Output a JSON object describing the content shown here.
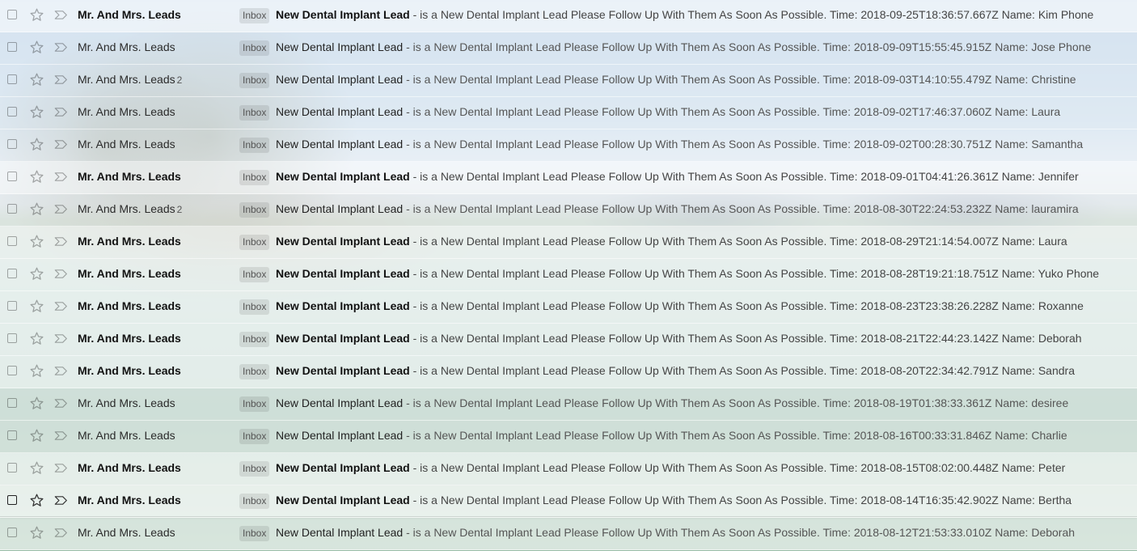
{
  "emails": [
    {
      "sender": "Mr. And Mrs. Leads",
      "count": "",
      "label": "Inbox",
      "subject": "New Dental Implant Lead",
      "snippet": " - is a New Dental Implant Lead Please Follow Up With Them As Soon As Possible. Time: 2018-09-25T18:36:57.667Z Name: Kim Phone",
      "unread": true
    },
    {
      "sender": "Mr. And Mrs. Leads",
      "count": "",
      "label": "Inbox",
      "subject": "New Dental Implant Lead",
      "snippet": " - is a New Dental Implant Lead Please Follow Up With Them As Soon As Possible. Time: 2018-09-09T15:55:45.915Z Name: Jose Phone",
      "unread": false
    },
    {
      "sender": "Mr. And Mrs. Leads",
      "count": "2",
      "label": "Inbox",
      "subject": "New Dental Implant Lead",
      "snippet": " - is a New Dental Implant Lead Please Follow Up With Them As Soon As Possible. Time: 2018-09-03T14:10:55.479Z Name: Christine",
      "unread": false
    },
    {
      "sender": "Mr. And Mrs. Leads",
      "count": "",
      "label": "Inbox",
      "subject": "New Dental Implant Lead",
      "snippet": " - is a New Dental Implant Lead Please Follow Up With Them As Soon As Possible. Time: 2018-09-02T17:46:37.060Z Name: Laura",
      "unread": false
    },
    {
      "sender": "Mr. And Mrs. Leads",
      "count": "",
      "label": "Inbox",
      "subject": "New Dental Implant Lead",
      "snippet": " - is a New Dental Implant Lead Please Follow Up With Them As Soon As Possible. Time: 2018-09-02T00:28:30.751Z Name: Samantha",
      "unread": false
    },
    {
      "sender": "Mr. And Mrs. Leads",
      "count": "",
      "label": "Inbox",
      "subject": "New Dental Implant Lead",
      "snippet": " - is a New Dental Implant Lead Please Follow Up With Them As Soon As Possible. Time: 2018-09-01T04:41:26.361Z Name: Jennifer",
      "unread": true
    },
    {
      "sender": "Mr. And Mrs. Leads",
      "count": "2",
      "label": "Inbox",
      "subject": "New Dental Implant Lead",
      "snippet": " - is a New Dental Implant Lead Please Follow Up With Them As Soon As Possible. Time: 2018-08-30T22:24:53.232Z Name: lauramira",
      "unread": false
    },
    {
      "sender": "Mr. And Mrs. Leads",
      "count": "",
      "label": "Inbox",
      "subject": "New Dental Implant Lead",
      "snippet": " - is a New Dental Implant Lead Please Follow Up With Them As Soon As Possible. Time: 2018-08-29T21:14:54.007Z Name: Laura",
      "unread": true
    },
    {
      "sender": "Mr. And Mrs. Leads",
      "count": "",
      "label": "Inbox",
      "subject": "New Dental Implant Lead",
      "snippet": " - is a New Dental Implant Lead Please Follow Up With Them As Soon As Possible. Time: 2018-08-28T19:21:18.751Z Name: Yuko Phone",
      "unread": true
    },
    {
      "sender": "Mr. And Mrs. Leads",
      "count": "",
      "label": "Inbox",
      "subject": "New Dental Implant Lead",
      "snippet": " - is a New Dental Implant Lead Please Follow Up With Them As Soon As Possible. Time: 2018-08-23T23:38:26.228Z Name: Roxanne",
      "unread": true
    },
    {
      "sender": "Mr. And Mrs. Leads",
      "count": "",
      "label": "Inbox",
      "subject": "New Dental Implant Lead",
      "snippet": " - is a New Dental Implant Lead Please Follow Up With Them As Soon As Possible. Time: 2018-08-21T22:44:23.142Z Name: Deborah",
      "unread": true
    },
    {
      "sender": "Mr. And Mrs. Leads",
      "count": "",
      "label": "Inbox",
      "subject": "New Dental Implant Lead",
      "snippet": " - is a New Dental Implant Lead Please Follow Up With Them As Soon As Possible. Time: 2018-08-20T22:34:42.791Z Name: Sandra",
      "unread": true
    },
    {
      "sender": "Mr. And Mrs. Leads",
      "count": "",
      "label": "Inbox",
      "subject": "New Dental Implant Lead",
      "snippet": " - is a New Dental Implant Lead Please Follow Up With Them As Soon As Possible. Time: 2018-08-19T01:38:33.361Z Name: desiree",
      "unread": false
    },
    {
      "sender": "Mr. And Mrs. Leads",
      "count": "",
      "label": "Inbox",
      "subject": "New Dental Implant Lead",
      "snippet": " - is a New Dental Implant Lead Please Follow Up With Them As Soon As Possible. Time: 2018-08-16T00:33:31.846Z Name: Charlie",
      "unread": false
    },
    {
      "sender": "Mr. And Mrs. Leads",
      "count": "",
      "label": "Inbox",
      "subject": "New Dental Implant Lead",
      "snippet": " - is a New Dental Implant Lead Please Follow Up With Them As Soon As Possible. Time: 2018-08-15T08:02:00.448Z Name: Peter",
      "unread": true
    },
    {
      "sender": "Mr. And Mrs. Leads",
      "count": "",
      "label": "Inbox",
      "subject": "New Dental Implant Lead",
      "snippet": " - is a New Dental Implant Lead Please Follow Up With Them As Soon As Possible. Time: 2018-08-14T16:35:42.902Z Name: Bertha",
      "unread": true
    },
    {
      "sender": "Mr. And Mrs. Leads",
      "count": "",
      "label": "Inbox",
      "subject": "New Dental Implant Lead",
      "snippet": " - is a New Dental Implant Lead Please Follow Up With Them As Soon As Possible. Time: 2018-08-12T21:53:33.010Z Name: Deborah",
      "unread": false
    }
  ],
  "icons": {
    "checkbox": "checkbox-icon",
    "star": "star-icon",
    "importance": "importance-marker-icon"
  },
  "hovered_row_index": 15
}
